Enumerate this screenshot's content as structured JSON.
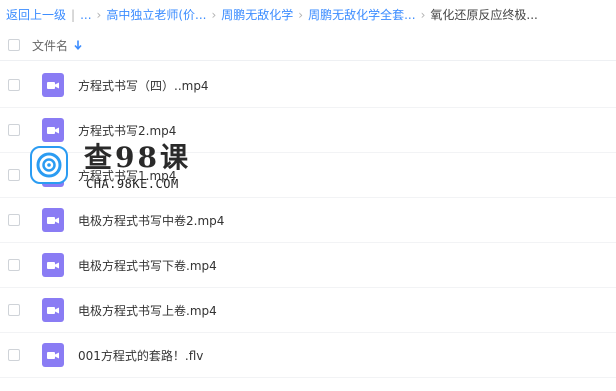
{
  "breadcrumb": {
    "items": [
      "返回上一级",
      "...",
      "高中独立老师(价...",
      "周鹏无敌化学",
      "周鹏无敌化学全套...",
      "氧化还原反应终极..."
    ],
    "separator_first": "|",
    "separator": "›"
  },
  "header": {
    "column_label": "文件名",
    "sort_icon": "arrow-down-icon"
  },
  "files": [
    {
      "name": "方程式书写（四）..mp4",
      "icon": "video-file-icon"
    },
    {
      "name": "方程式书写2.mp4",
      "icon": "video-file-icon"
    },
    {
      "name": "方程式书写1.mp4",
      "icon": "video-file-icon"
    },
    {
      "name": "电极方程式书写中卷2.mp4",
      "icon": "video-file-icon"
    },
    {
      "name": "电极方程式书写下卷.mp4",
      "icon": "video-file-icon"
    },
    {
      "name": "电极方程式书写上卷.mp4",
      "icon": "video-file-icon"
    },
    {
      "name": "001方程式的套路！.flv",
      "icon": "video-file-icon"
    }
  ],
  "watermark": {
    "title": "查98课",
    "subtitle": "CHA.98KE.COM"
  },
  "colors": {
    "link": "#3b8cff",
    "file_icon": "#8a7cf4",
    "watermark_logo": "#2b9cf2"
  }
}
